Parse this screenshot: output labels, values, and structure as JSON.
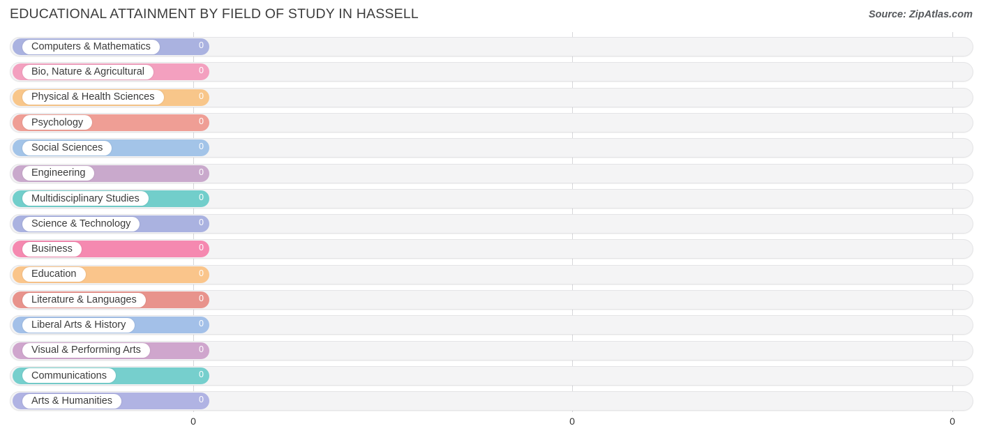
{
  "header": {
    "title": "EDUCATIONAL ATTAINMENT BY FIELD OF STUDY IN HASSELL",
    "source": "Source: ZipAtlas.com"
  },
  "axis": {
    "ticks": [
      {
        "label": "0",
        "x": 277
      },
      {
        "label": "0",
        "x": 820
      },
      {
        "label": "0",
        "x": 1365
      }
    ]
  },
  "chart_data": {
    "type": "bar",
    "orientation": "horizontal",
    "title": "EDUCATIONAL ATTAINMENT BY FIELD OF STUDY IN HASSELL",
    "xlabel": "",
    "ylabel": "",
    "xlim": [
      0,
      0
    ],
    "xticks": [
      "0",
      "0",
      "0"
    ],
    "grid": true,
    "legend": "none",
    "categories": [
      "Computers & Mathematics",
      "Bio, Nature & Agricultural",
      "Physical & Health Sciences",
      "Psychology",
      "Social Sciences",
      "Engineering",
      "Multidisciplinary Studies",
      "Science & Technology",
      "Business",
      "Education",
      "Literature & Languages",
      "Liberal Arts & History",
      "Visual & Performing Arts",
      "Communications",
      "Arts & Humanities"
    ],
    "values": [
      0,
      0,
      0,
      0,
      0,
      0,
      0,
      0,
      0,
      0,
      0,
      0,
      0,
      0,
      0
    ],
    "value_labels": [
      "0",
      "0",
      "0",
      "0",
      "0",
      "0",
      "0",
      "0",
      "0",
      "0",
      "0",
      "0",
      "0",
      "0",
      "0"
    ],
    "colors": [
      "#aab2e0",
      "#f3a0bf",
      "#f8c68a",
      "#ef9e95",
      "#a3c4e8",
      "#c9a9cc",
      "#72cecb",
      "#aab2e0",
      "#f589b0",
      "#fac58b",
      "#e8938c",
      "#a3c0e8",
      "#cfa6cd",
      "#76cfcd",
      "#b0b3e3"
    ]
  },
  "rows": [
    {
      "label": "Computers & Mathematics",
      "value": "0",
      "color": "#aab2e0"
    },
    {
      "label": "Bio, Nature & Agricultural",
      "value": "0",
      "color": "#f3a0bf"
    },
    {
      "label": "Physical & Health Sciences",
      "value": "0",
      "color": "#f8c68a"
    },
    {
      "label": "Psychology",
      "value": "0",
      "color": "#ef9e95"
    },
    {
      "label": "Social Sciences",
      "value": "0",
      "color": "#a3c4e8"
    },
    {
      "label": "Engineering",
      "value": "0",
      "color": "#c9a9cc"
    },
    {
      "label": "Multidisciplinary Studies",
      "value": "0",
      "color": "#72cecb"
    },
    {
      "label": "Science & Technology",
      "value": "0",
      "color": "#aab2e0"
    },
    {
      "label": "Business",
      "value": "0",
      "color": "#f589b0"
    },
    {
      "label": "Education",
      "value": "0",
      "color": "#fac58b"
    },
    {
      "label": "Literature & Languages",
      "value": "0",
      "color": "#e8938c"
    },
    {
      "label": "Liberal Arts & History",
      "value": "0",
      "color": "#a3c0e8"
    },
    {
      "label": "Visual & Performing Arts",
      "value": "0",
      "color": "#cfa6cd"
    },
    {
      "label": "Communications",
      "value": "0",
      "color": "#76cfcd"
    },
    {
      "label": "Arts & Humanities",
      "value": "0",
      "color": "#b0b3e3"
    }
  ]
}
